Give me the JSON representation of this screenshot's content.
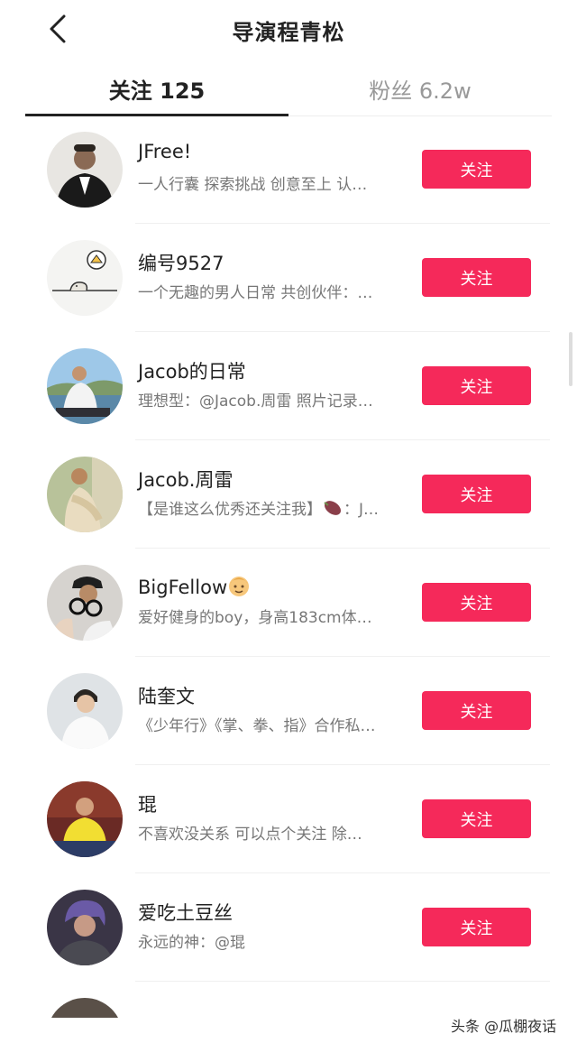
{
  "header": {
    "title": "导演程青松"
  },
  "tabs": [
    {
      "label": "关注 125"
    },
    {
      "label": "粉丝 6.2w"
    }
  ],
  "follow_label": "关注",
  "users": [
    {
      "name": "JFree!",
      "desc": "一人行囊 探索挑战 创意至上 认…"
    },
    {
      "name": "编号9527",
      "desc": "一个无趣的男人日常 共创伙伴：…"
    },
    {
      "name": "Jacob的日常",
      "desc": "理想型：@Jacob.周雷 照片记录…"
    },
    {
      "name": "Jacob.周雷",
      "desc": "【是谁这么优秀还关注我】",
      "desc_tail": "：J…"
    },
    {
      "name": "BigFellow",
      "desc": "爱好健身的boy，身高183cm体…"
    },
    {
      "name": "陆奎文",
      "desc": "《少年行》《掌、拳、指》合作私…"
    },
    {
      "name": "琨",
      "desc": "不喜欢没关系 可以点个关注 除…"
    },
    {
      "name": "爱吃土豆丝",
      "desc": "永远的神：@琨"
    }
  ],
  "watermark": "头条 @瓜棚夜话",
  "colors": {
    "accent": "#f5295a",
    "text": "#222222",
    "muted": "#777777"
  }
}
